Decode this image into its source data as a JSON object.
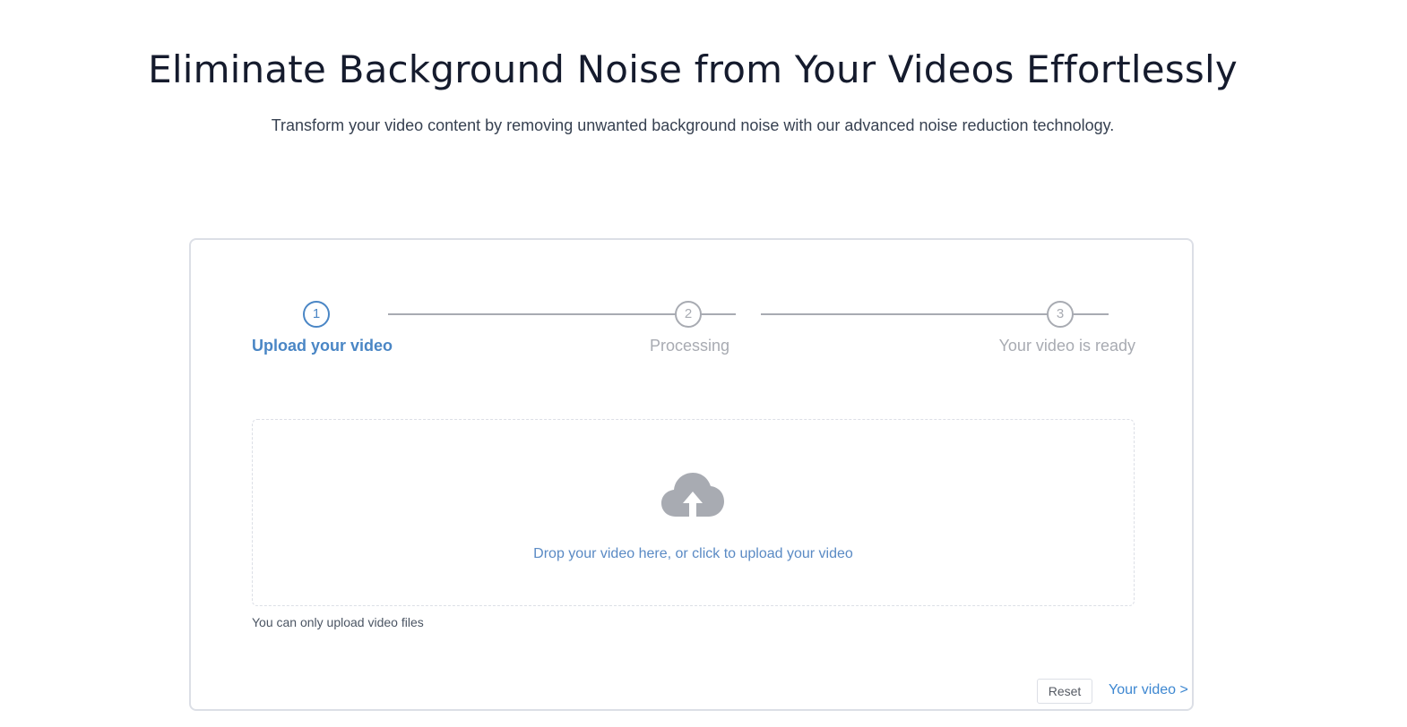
{
  "hero": {
    "title": "Eliminate Background Noise from Your Videos Effortlessly",
    "subtitle": "Transform your video content by removing unwanted background noise with our advanced noise reduction technology."
  },
  "steps": [
    {
      "number": "1",
      "label": "Upload your video",
      "state": "active"
    },
    {
      "number": "2",
      "label": "Processing",
      "state": "pending"
    },
    {
      "number": "3",
      "label": "Your video is ready",
      "state": "pending"
    }
  ],
  "upload": {
    "icon": "cloud-upload-icon",
    "prompt": "Drop your video here, or click to upload your video",
    "hint": "You can only upload video files"
  },
  "actions": {
    "reset_label": "Reset",
    "next_label": "Your video >"
  },
  "colors": {
    "accent": "#4a86c5",
    "inactive": "#a8abb2",
    "link": "#3d87d1",
    "title": "#151b2d"
  }
}
